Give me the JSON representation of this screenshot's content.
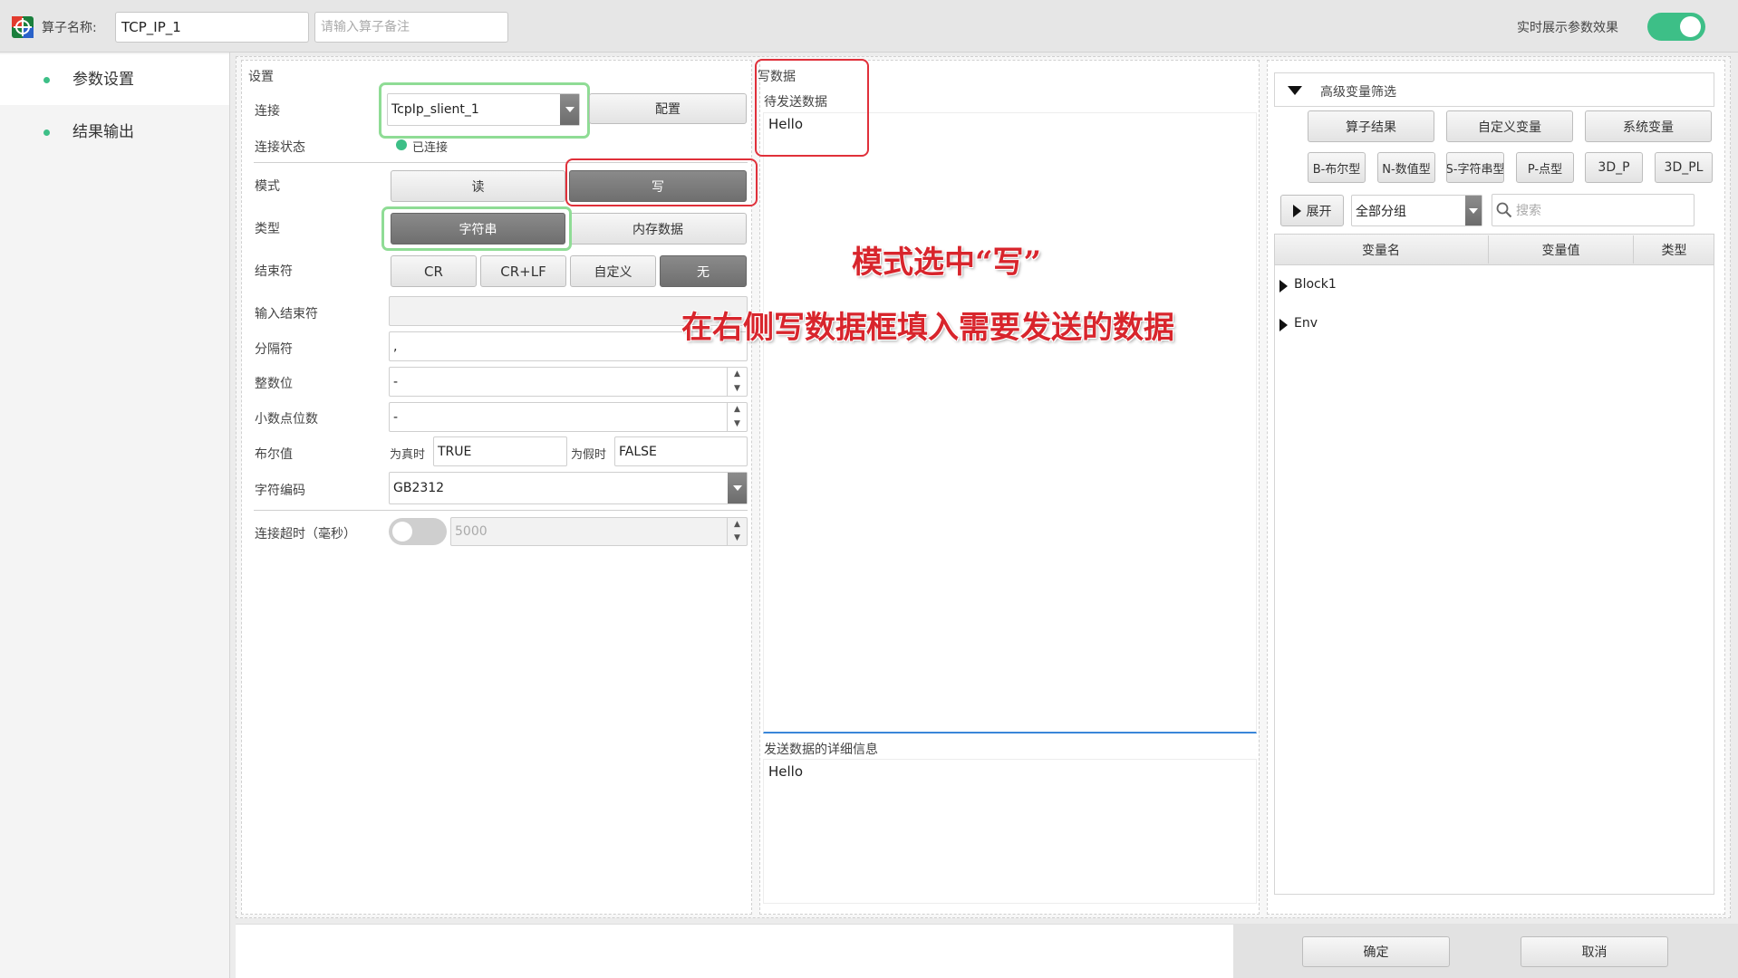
{
  "header": {
    "name_label": "算子名称:",
    "name_value": "TCP_IP_1",
    "remark_placeholder": "请输入算子备注",
    "realtime_label": "实时展示参数效果"
  },
  "sidebar": {
    "items": [
      {
        "label": "参数设置"
      },
      {
        "label": "结果输出"
      }
    ]
  },
  "settings": {
    "section_title": "设置",
    "connection_label": "连接",
    "connection_value": "TcpIp_slient_1",
    "configure_button": "配置",
    "status_label": "连接状态",
    "status_value": "已连接",
    "mode_label": "模式",
    "mode_options": [
      "读",
      "写"
    ],
    "type_label": "类型",
    "type_options": [
      "字符串",
      "内存数据"
    ],
    "terminator_label": "结束符",
    "terminator_options": [
      "CR",
      "CR+LF",
      "自定义",
      "无"
    ],
    "input_terminator_label": "输入结束符",
    "separator_label": "分隔符",
    "separator_value": ",",
    "integer_digits_label": "整数位",
    "integer_digits_value": "-",
    "decimal_places_label": "小数点位数",
    "decimal_places_value": "-",
    "bool_label": "布尔值",
    "true_label": "为真时",
    "true_value": "TRUE",
    "false_label": "为假时",
    "false_value": "FALSE",
    "encoding_label": "字符编码",
    "encoding_value": "GB2312",
    "timeout_label": "连接超时（毫秒）",
    "timeout_value": "5000"
  },
  "write_panel": {
    "title": "写数据",
    "pending_label": "待发送数据",
    "pending_value": "Hello",
    "detail_label": "发送数据的详细信息",
    "detail_value": "Hello"
  },
  "annotations": {
    "line1": "模式选中“写”",
    "line2": "在右侧写数据框填入需要发送的数据"
  },
  "variables": {
    "filter_title": "高级变量筛选",
    "category_buttons": [
      "算子结果",
      "自定义变量",
      "系统变量"
    ],
    "type_buttons": [
      "B-布尔型",
      "N-数值型",
      "S-字符串型",
      "P-点型",
      "3D_P",
      "3D_PL"
    ],
    "expand_button": "展开",
    "group_value": "全部分组",
    "search_placeholder": "搜索",
    "columns": [
      "变量名",
      "变量值",
      "类型"
    ],
    "rows": [
      "Block1",
      "Env"
    ]
  },
  "footer": {
    "ok_button": "确定",
    "cancel_button": "取消"
  },
  "colors": {
    "accent_green": "#3dbf87",
    "annotation_red": "#d8252c"
  }
}
